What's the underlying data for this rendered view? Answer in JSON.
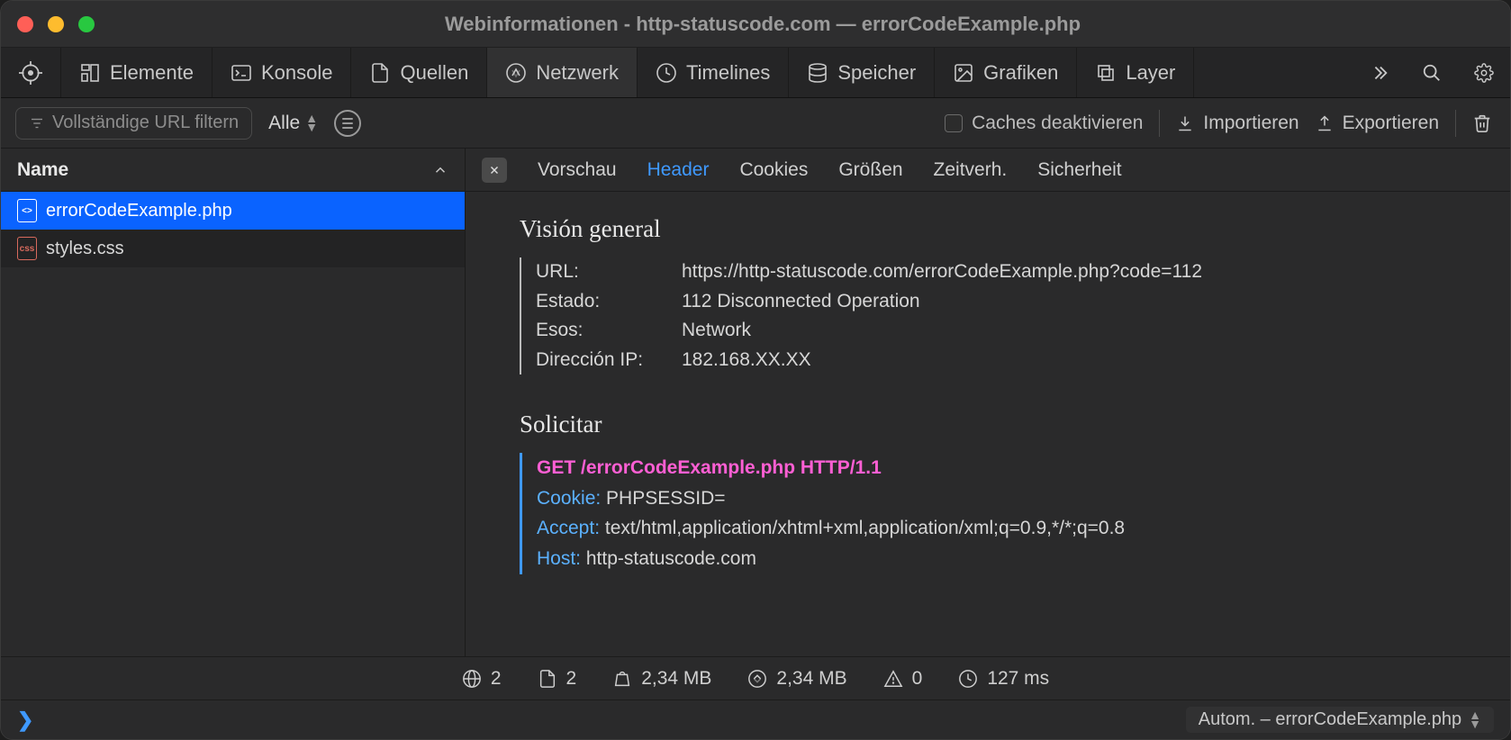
{
  "window": {
    "title": "Webinformationen - http-statuscode.com — errorCodeExample.php"
  },
  "tabs": [
    {
      "label": "Elemente",
      "icon": "elements"
    },
    {
      "label": "Konsole",
      "icon": "console"
    },
    {
      "label": "Quellen",
      "icon": "sources"
    },
    {
      "label": "Netzwerk",
      "icon": "network",
      "active": true
    },
    {
      "label": "Timelines",
      "icon": "timelines"
    },
    {
      "label": "Speicher",
      "icon": "storage"
    },
    {
      "label": "Grafiken",
      "icon": "graphics"
    },
    {
      "label": "Layer",
      "icon": "layers"
    }
  ],
  "filterbar": {
    "filter_placeholder": "Vollständige URL filtern",
    "dropdown": "Alle",
    "disable_caches": "Caches deaktivieren",
    "import": "Importieren",
    "export": "Exportieren"
  },
  "sidebar": {
    "header": "Name",
    "rows": [
      {
        "name": "errorCodeExample.php",
        "type": "php",
        "selected": true
      },
      {
        "name": "styles.css",
        "type": "css"
      }
    ]
  },
  "detail_tabs": [
    {
      "label": "Vorschau"
    },
    {
      "label": "Header",
      "active": true
    },
    {
      "label": "Cookies"
    },
    {
      "label": "Größen"
    },
    {
      "label": "Zeitverh."
    },
    {
      "label": "Sicherheit"
    }
  ],
  "overview": {
    "title": "Visión general",
    "rows": [
      {
        "k": "URL:",
        "v": "https://http-statuscode.com/errorCodeExample.php?code=112"
      },
      {
        "k": "Estado:",
        "v": "112 Disconnected Operation"
      },
      {
        "k": "Esos:",
        "v": "Network"
      },
      {
        "k": "Dirección IP:",
        "v": "182.168.XX.XX"
      }
    ]
  },
  "request": {
    "title": "Solicitar",
    "first_line": "GET /errorCodeExample.php HTTP/1.1",
    "headers": [
      {
        "k": "Cookie:",
        "v": "PHPSESSID="
      },
      {
        "k": "Accept:",
        "v": "text/html,application/xhtml+xml,application/xml;q=0.9,*/*;q=0.8"
      },
      {
        "k": "Host:",
        "v": "http-statuscode.com"
      }
    ]
  },
  "statusbar": {
    "domains": "2",
    "resources": "2",
    "size1": "2,34 MB",
    "size2": "2,34 MB",
    "errors": "0",
    "time": "127 ms"
  },
  "console": {
    "right": "Autom. – errorCodeExample.php"
  }
}
